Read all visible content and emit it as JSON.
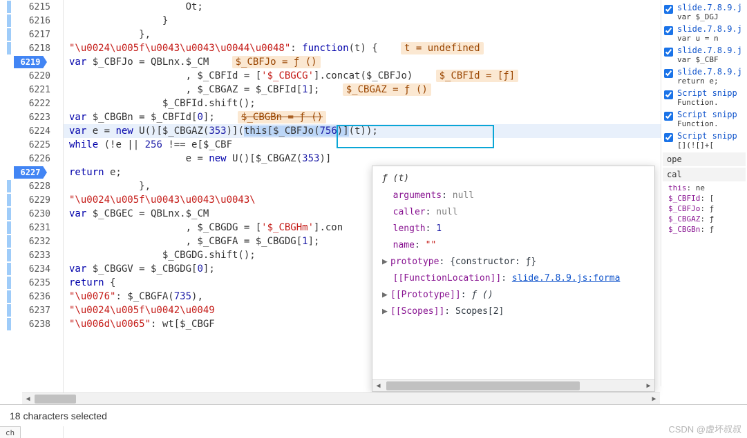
{
  "lines": [
    {
      "n": "6215",
      "type": "plain",
      "indent": 20,
      "txt": "Ot;"
    },
    {
      "n": "6216",
      "type": "plain",
      "indent": 16,
      "txt": "}"
    },
    {
      "n": "6217",
      "type": "plain",
      "indent": 12,
      "txt": "},"
    },
    {
      "n": "6218",
      "type": "fnhead",
      "indent": 12,
      "str": "\"\\u0024\\u005f\\u0043\\u0043\\u0044\\u0048\"",
      "ann": "t = undefined"
    },
    {
      "n": "6219",
      "bp": true,
      "type": "vardecl",
      "indent": 16,
      "lhs": "$_CBFJo",
      "rhs": "QBLnx.$_CM",
      "ann": "$_CBFJo = ƒ ()"
    },
    {
      "n": "6220",
      "type": "concat",
      "indent": 20,
      "lhs": "$_CBFId",
      "s": "'$_CBGCG'",
      "r": "$_CBFJo",
      "ann": "$_CBFId = [ƒ]"
    },
    {
      "n": "6221",
      "type": "idx",
      "indent": 20,
      "lhs": "$_CBGAZ",
      "src": "$_CBFId",
      "i": "1",
      "ann": "$_CBGAZ = ƒ ()"
    },
    {
      "n": "6222",
      "type": "plain",
      "indent": 16,
      "txt": "$_CBFId.shift();"
    },
    {
      "n": "6223",
      "type": "idx2",
      "indent": 16,
      "lhs": "$_CBGBn",
      "src": "$_CBFId",
      "i": "0",
      "ann": "$_CBGBn = ƒ ()",
      "strike": true
    },
    {
      "n": "6224",
      "type": "line6224",
      "indent": 16
    },
    {
      "n": "6225",
      "type": "while",
      "indent": 16,
      "n1": "256"
    },
    {
      "n": "6226",
      "type": "assign_new",
      "indent": 20,
      "rhs_num": "353"
    },
    {
      "n": "6227",
      "bp": true,
      "type": "return_e",
      "indent": 16
    },
    {
      "n": "6228",
      "type": "plain",
      "indent": 12,
      "txt": "},"
    },
    {
      "n": "6229",
      "type": "strline",
      "indent": 12,
      "str": "\"\\u0024\\u005f\\u0043\\u0043\\u0043\\"
    },
    {
      "n": "6230",
      "type": "vardecl",
      "indent": 16,
      "lhs": "$_CBGEC",
      "rhs": "QBLnx.$_CM"
    },
    {
      "n": "6231",
      "type": "concat2",
      "indent": 20,
      "lhs": "$_CBGDG",
      "s": "'$_CBGHm'"
    },
    {
      "n": "6232",
      "type": "idx",
      "indent": 20,
      "lhs": "$_CBGFA",
      "src": "$_CBGDG",
      "i": "1"
    },
    {
      "n": "6233",
      "type": "plain",
      "indent": 16,
      "txt": "$_CBGDG.shift();"
    },
    {
      "n": "6234",
      "type": "idx2",
      "indent": 16,
      "lhs": "$_CBGGV",
      "src": "$_CBGDG",
      "i": "0"
    },
    {
      "n": "6235",
      "type": "return_obj",
      "indent": 16
    },
    {
      "n": "6236",
      "type": "objcall",
      "indent": 20,
      "key": "\"\\u0076\"",
      "fn": "$_CBGFA",
      "arg": "735"
    },
    {
      "n": "6237",
      "type": "strline",
      "indent": 20,
      "str": "\"\\u0024\\u005f\\u0042\\u0049"
    },
    {
      "n": "6238",
      "type": "objcall2",
      "indent": 20,
      "key": "\"\\u006d\\u0065\"",
      "fn": "wt",
      "arg": "$_CBGF"
    }
  ],
  "toolTip": {
    "sig": "ƒ (t)",
    "rows": [
      {
        "k": "arguments",
        "v": "null",
        "cls": "v-null"
      },
      {
        "k": "caller",
        "v": "null",
        "cls": "v-null"
      },
      {
        "k": "length",
        "v": "1",
        "cls": "v-num"
      },
      {
        "k": "name",
        "v": "\"\"",
        "cls": "v-str"
      }
    ],
    "proto": "{constructor: ƒ}",
    "fnloc_label": "[[FunctionLocation]]",
    "fnloc_link": "slide.7.8.9.js:forma",
    "proto2": "ƒ ()",
    "scopes": "Scopes[2]"
  },
  "rightPanel": {
    "items": [
      {
        "t1": "slide.7.8.9.j",
        "t2": "var $_DGJ"
      },
      {
        "t1": "slide.7.8.9.j",
        "t2": "var u = n"
      },
      {
        "t1": "slide.7.8.9.j",
        "t2": "var $_CBF"
      },
      {
        "t1": "slide.7.8.9.j",
        "t2": "return e;"
      },
      {
        "t1": "Script snipp",
        "t2": "Function."
      },
      {
        "t1": "Script snipp",
        "t2": "Function."
      },
      {
        "t1": "Script snipp",
        "t2": "[](![]+["
      }
    ],
    "scope_hdr": "ope",
    "local": "cal",
    "scope_rows": [
      {
        "k": "this",
        "v": ": ne"
      },
      {
        "k": "$_CBFId",
        "v": ": ["
      },
      {
        "k": "$_CBFJo",
        "v": ": ƒ"
      },
      {
        "k": "$_CBGAZ",
        "v": ": ƒ"
      },
      {
        "k": "$_CBGBn",
        "v": ": ƒ"
      }
    ]
  },
  "statusBar": "18 characters selected",
  "bottomTab": "ch",
  "watermark": "CSDN @虚坏叔叔"
}
